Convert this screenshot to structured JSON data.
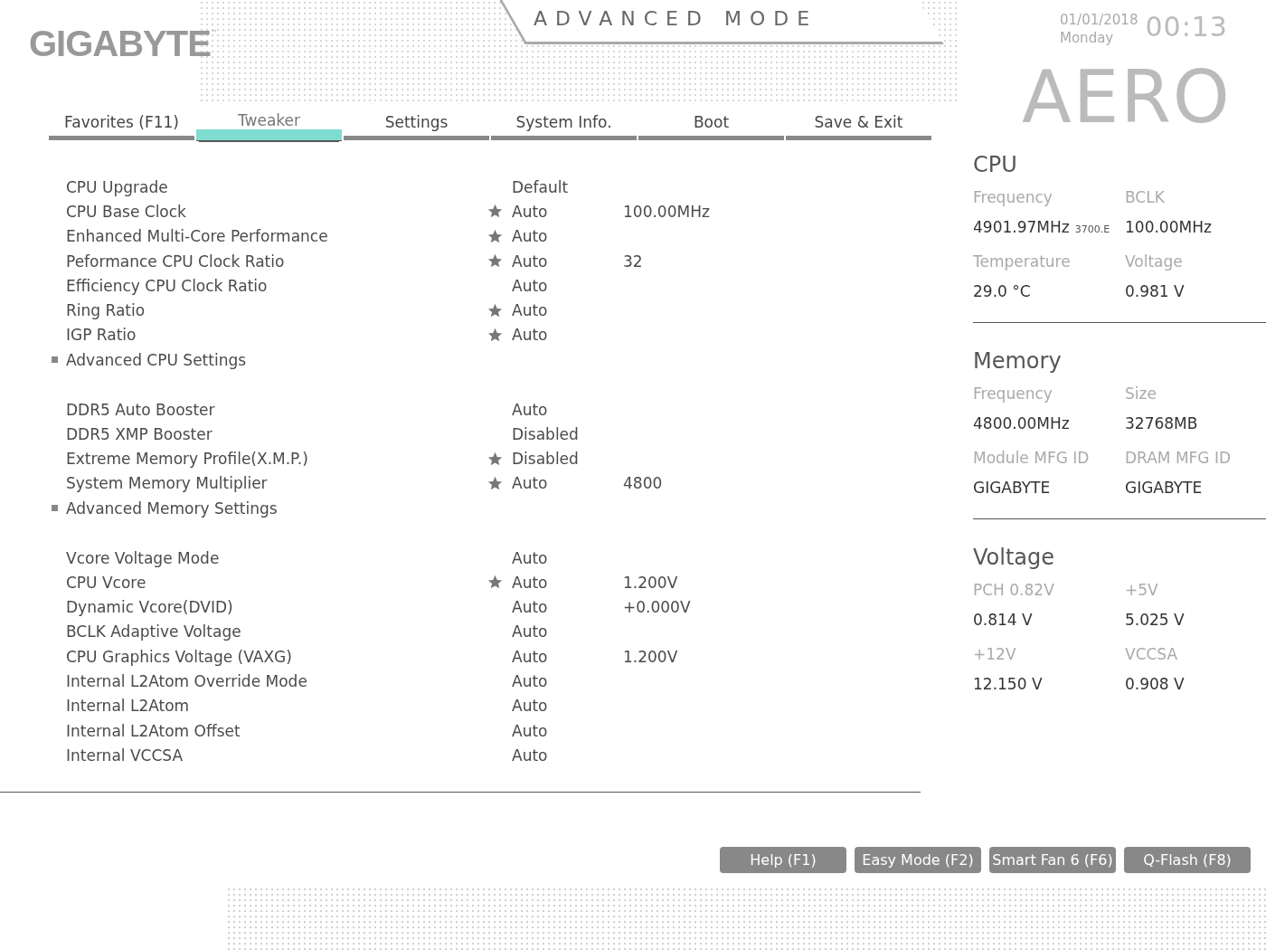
{
  "header": {
    "logo": "GIGABYTE",
    "logo_mark": "™",
    "mode": "ADVANCED MODE",
    "date": "01/01/2018",
    "day": "Monday",
    "time": "00:13",
    "brand": "AERO"
  },
  "tabs": [
    {
      "label": "Favorites (F11)",
      "selected": false
    },
    {
      "label": "Tweaker",
      "selected": true
    },
    {
      "label": "Settings",
      "selected": false
    },
    {
      "label": "System Info.",
      "selected": false
    },
    {
      "label": "Boot",
      "selected": false
    },
    {
      "label": "Save & Exit",
      "selected": false
    }
  ],
  "groups": [
    {
      "rows": [
        {
          "kind": "setting",
          "label": "CPU Upgrade",
          "favorite": false,
          "value": "Default"
        },
        {
          "kind": "setting",
          "label": "CPU Base Clock",
          "favorite": true,
          "value": "Auto",
          "current": "100.00MHz"
        },
        {
          "kind": "setting",
          "label": "Enhanced Multi-Core Performance",
          "favorite": true,
          "value": "Auto"
        },
        {
          "kind": "setting",
          "label": "Peformance CPU Clock Ratio",
          "favorite": true,
          "value": "Auto",
          "current": "32"
        },
        {
          "kind": "setting",
          "label": "Efficiency CPU Clock Ratio",
          "favorite": false,
          "value": "Auto"
        },
        {
          "kind": "setting",
          "label": "Ring Ratio",
          "favorite": true,
          "value": "Auto"
        },
        {
          "kind": "setting",
          "label": "IGP Ratio",
          "favorite": true,
          "value": "Auto"
        },
        {
          "kind": "submenu",
          "label": "Advanced CPU Settings"
        }
      ]
    },
    {
      "rows": [
        {
          "kind": "setting",
          "label": "DDR5 Auto Booster",
          "favorite": false,
          "value": "Auto"
        },
        {
          "kind": "setting",
          "label": "DDR5 XMP Booster",
          "favorite": false,
          "value": "Disabled"
        },
        {
          "kind": "setting",
          "label": "Extreme Memory Profile(X.M.P.)",
          "favorite": true,
          "value": "Disabled"
        },
        {
          "kind": "setting",
          "label": "System Memory Multiplier",
          "favorite": true,
          "value": "Auto",
          "current": "4800"
        },
        {
          "kind": "submenu",
          "label": "Advanced Memory Settings"
        }
      ]
    },
    {
      "rows": [
        {
          "kind": "setting",
          "label": "Vcore Voltage Mode",
          "favorite": false,
          "value": "Auto"
        },
        {
          "kind": "setting",
          "label": "CPU Vcore",
          "favorite": true,
          "value": "Auto",
          "current": "1.200V"
        },
        {
          "kind": "setting",
          "label": "Dynamic Vcore(DVID)",
          "favorite": false,
          "value": "Auto",
          "current": "+0.000V"
        },
        {
          "kind": "setting",
          "label": "BCLK Adaptive Voltage",
          "favorite": false,
          "value": "Auto"
        },
        {
          "kind": "setting",
          "label": "CPU Graphics Voltage (VAXG)",
          "favorite": false,
          "value": "Auto",
          "current": "1.200V"
        },
        {
          "kind": "setting",
          "label": "Internal L2Atom Override Mode",
          "favorite": false,
          "value": "Auto"
        },
        {
          "kind": "setting",
          "label": "Internal L2Atom",
          "favorite": false,
          "value": "Auto"
        },
        {
          "kind": "setting",
          "label": "Internal L2Atom Offset",
          "favorite": false,
          "value": "Auto"
        },
        {
          "kind": "setting",
          "label": "Internal VCCSA",
          "favorite": false,
          "value": "Auto"
        }
      ]
    }
  ],
  "info": [
    {
      "title": "CPU",
      "items": [
        {
          "label": "Frequency",
          "value": "4901.97MHz",
          "note": "3700.E"
        },
        {
          "label": "BCLK",
          "value": "100.00MHz"
        },
        {
          "label": "Temperature",
          "value": "29.0 °C"
        },
        {
          "label": "Voltage",
          "value": "0.981 V"
        }
      ]
    },
    {
      "title": "Memory",
      "items": [
        {
          "label": "Frequency",
          "value": "4800.00MHz"
        },
        {
          "label": "Size",
          "value": "32768MB"
        },
        {
          "label": "Module MFG ID",
          "value": "GIGABYTE"
        },
        {
          "label": "DRAM MFG ID",
          "value": "GIGABYTE"
        }
      ]
    },
    {
      "title": "Voltage",
      "items": [
        {
          "label": "PCH 0.82V",
          "value": "0.814 V"
        },
        {
          "label": "+5V",
          "value": "5.025 V"
        },
        {
          "label": "+12V",
          "value": "12.150 V"
        },
        {
          "label": "VCCSA",
          "value": "0.908 V"
        }
      ]
    }
  ],
  "buttons": [
    "Help (F1)",
    "Easy Mode (F2)",
    "Smart Fan 6 (F6)",
    "Q-Flash (F8)"
  ]
}
